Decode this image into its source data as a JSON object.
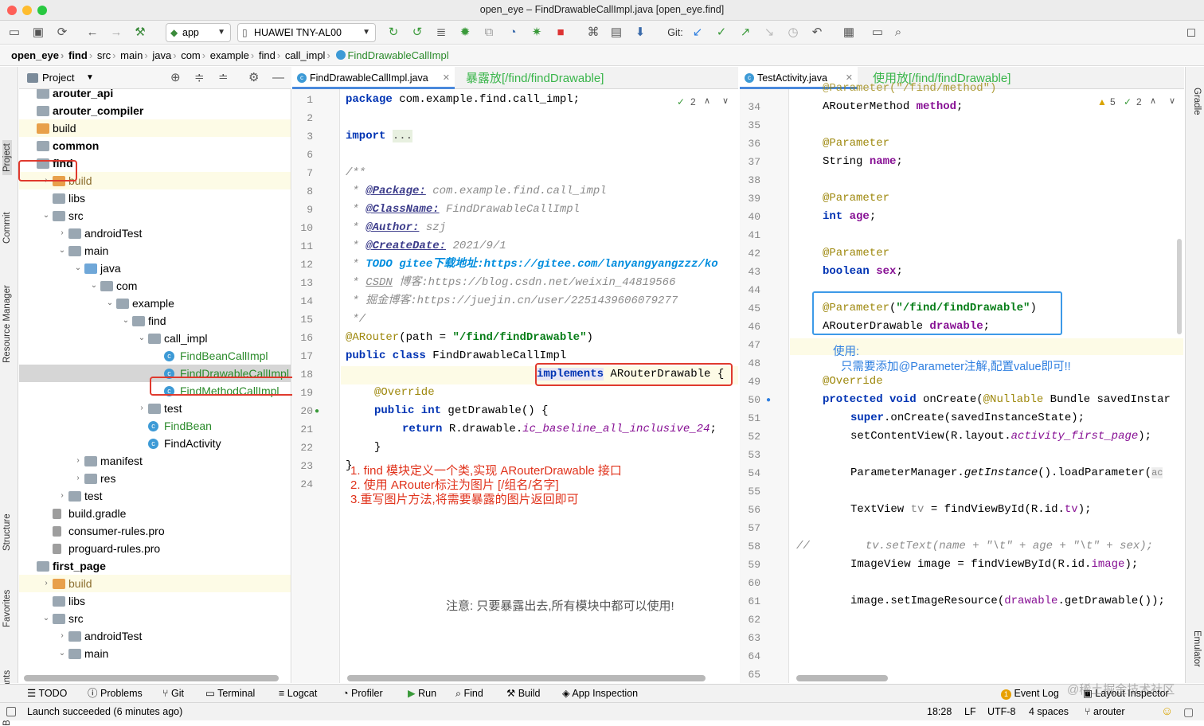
{
  "window": {
    "title": "open_eye – FindDrawableCallImpl.java [open_eye.find]"
  },
  "toolbar": {
    "run_config": "app",
    "device": "HUAWEI TNY-AL00",
    "git_label": "Git:"
  },
  "breadcrumb": [
    "open_eye",
    "find",
    "src",
    "main",
    "java",
    "com",
    "example",
    "find",
    "call_impl",
    "FindDrawableCallImpl"
  ],
  "left_tools": [
    "Project",
    "Commit",
    "Resource Manager",
    "Structure",
    "Favorites",
    "Build Variants"
  ],
  "right_tools": [
    "Gradle",
    "Emulator"
  ],
  "project_panel": {
    "title": "Project"
  },
  "tree": [
    {
      "label": "arouter_api",
      "depth": 0,
      "arrow": "",
      "icon": "mod",
      "bold": true
    },
    {
      "label": "arouter_compiler",
      "depth": 0,
      "arrow": "",
      "icon": "mod",
      "bold": true
    },
    {
      "label": "build",
      "depth": 0,
      "arrow": "",
      "icon": "orange",
      "hl": true
    },
    {
      "label": "common",
      "depth": 0,
      "arrow": "",
      "icon": "mod",
      "bold": true
    },
    {
      "label": "find",
      "depth": 0,
      "arrow": "",
      "icon": "mod",
      "bold": true
    },
    {
      "label": "build",
      "depth": 1,
      "arrow": "›",
      "icon": "orange",
      "hl": true,
      "color": "#8c6e2f"
    },
    {
      "label": "libs",
      "depth": 1,
      "arrow": "",
      "icon": "folder"
    },
    {
      "label": "src",
      "depth": 1,
      "arrow": "⌄",
      "icon": "folder"
    },
    {
      "label": "androidTest",
      "depth": 2,
      "arrow": "›",
      "icon": "folder"
    },
    {
      "label": "main",
      "depth": 2,
      "arrow": "⌄",
      "icon": "folder"
    },
    {
      "label": "java",
      "depth": 3,
      "arrow": "⌄",
      "icon": "blue"
    },
    {
      "label": "com",
      "depth": 4,
      "arrow": "⌄",
      "icon": "folder"
    },
    {
      "label": "example",
      "depth": 5,
      "arrow": "⌄",
      "icon": "folder"
    },
    {
      "label": "find",
      "depth": 6,
      "arrow": "⌄",
      "icon": "folder"
    },
    {
      "label": "call_impl",
      "depth": 7,
      "arrow": "⌄",
      "icon": "folder"
    },
    {
      "label": "FindBeanCallImpl",
      "depth": 8,
      "arrow": "",
      "icon": "class",
      "color": "#2a8a2a"
    },
    {
      "label": "FindDrawableCallImpl",
      "depth": 8,
      "arrow": "",
      "icon": "class",
      "color": "#2a8a2a",
      "selected": true
    },
    {
      "label": "FindMethodCallImpl",
      "depth": 8,
      "arrow": "",
      "icon": "class",
      "color": "#2a8a2a"
    },
    {
      "label": "test",
      "depth": 7,
      "arrow": "›",
      "icon": "folder"
    },
    {
      "label": "FindBean",
      "depth": 7,
      "arrow": "",
      "icon": "class",
      "color": "#2a8a2a"
    },
    {
      "label": "FindActivity",
      "depth": 7,
      "arrow": "",
      "icon": "class"
    },
    {
      "label": "manifest",
      "depth": 3,
      "arrow": "›",
      "icon": "folder"
    },
    {
      "label": "res",
      "depth": 3,
      "arrow": "›",
      "icon": "folder"
    },
    {
      "label": "test",
      "depth": 2,
      "arrow": "›",
      "icon": "folder"
    },
    {
      "label": "build.gradle",
      "depth": 1,
      "arrow": "",
      "icon": "file"
    },
    {
      "label": "consumer-rules.pro",
      "depth": 1,
      "arrow": "",
      "icon": "file"
    },
    {
      "label": "proguard-rules.pro",
      "depth": 1,
      "arrow": "",
      "icon": "file"
    },
    {
      "label": "first_page",
      "depth": 0,
      "arrow": "",
      "icon": "mod",
      "bold": true
    },
    {
      "label": "build",
      "depth": 1,
      "arrow": "›",
      "icon": "orange",
      "hl": true,
      "color": "#8c6e2f"
    },
    {
      "label": "libs",
      "depth": 1,
      "arrow": "",
      "icon": "folder"
    },
    {
      "label": "src",
      "depth": 1,
      "arrow": "⌄",
      "icon": "folder"
    },
    {
      "label": "androidTest",
      "depth": 2,
      "arrow": "›",
      "icon": "folder"
    },
    {
      "label": "main",
      "depth": 2,
      "arrow": "⌄",
      "icon": "folder"
    }
  ],
  "editor_left": {
    "tab": "FindDrawableCallImpl.java",
    "annotation": "暴露放[/find/findDrawable]",
    "check_count": "2",
    "line_numbers": [
      "1",
      "2",
      "3",
      "6",
      "7",
      "8",
      "9",
      "10",
      "11",
      "12",
      "13",
      "14",
      "15",
      "16",
      "17",
      "18",
      "19",
      "20",
      "21",
      "22",
      "23",
      "24"
    ],
    "code": {
      "l1a": "package ",
      "l1b": "com.example.find.call_impl;",
      "l3a": "import ",
      "l3b": "...",
      "l5": "/**",
      "l6a": " * ",
      "l6b": "@Package:",
      "l6c": " com.example.find.call_impl",
      "l7a": " * ",
      "l7b": "@ClassName:",
      "l7c": " FindDrawableCallImpl",
      "l8a": " * ",
      "l8b": "@Author:",
      "l8c": " szj",
      "l9a": " * ",
      "l9b": "@CreateDate:",
      "l9c": " 2021/9/1",
      "l10a": " * ",
      "l10b": "TODO gitee下载地址:https://gitee.com/lanyangyangzzz/ko",
      "l11a": " * ",
      "l11b": "CSDN",
      "l11c": " 博客:https://blog.csdn.net/weixin_44819566",
      "l12": " * 掘金博客:https://juejin.cn/user/2251439606079277",
      "l13": " */",
      "l14a": "@ARouter",
      "l14b": "(path = ",
      "l14c": "\"/find/findDrawable\"",
      "l14d": ")",
      "l15a": "public class ",
      "l15b": "FindDrawableCallImpl",
      "l16a": "implements",
      "l16b": " ARouterDrawable {",
      "l18": "@Override",
      "l19a": "public int ",
      "l19b": "getDrawable",
      "l19c": "() {",
      "l20a": "return ",
      "l20b": "R.drawable.",
      "l20c": "ic_baseline_all_inclusive_24",
      ";": ";",
      "l21": "}",
      "l22": "}"
    },
    "notes": [
      "1. find 模块定义一个类,实现 ARouterDrawable 接口",
      "2. 使用 ARouter标注为图片 [/组名/名字]",
      "3.重写图片方法,将需要暴露的图片返回即可"
    ],
    "note_bottom": "注意: 只要暴露出去,所有模块中都可以使用!"
  },
  "editor_right": {
    "tab": "TestActivity.java",
    "annotation": "使用放[/find/findDrawable]",
    "warn_count": "5",
    "check_count": "2",
    "line_numbers": [
      "34",
      "35",
      "36",
      "37",
      "38",
      "39",
      "40",
      "41",
      "42",
      "43",
      "44",
      "45",
      "46",
      "47",
      "48",
      "49",
      "50",
      "51",
      "52",
      "53",
      "54",
      "55",
      "56",
      "57",
      "58",
      "59",
      "60",
      "61",
      "62",
      "63",
      "64",
      "65"
    ],
    "code": {
      "r0": "@Parameter(\"/find/method\")",
      "r34a": "ARouterMethod ",
      "r34b": "method",
      ";": ";",
      "r36": "@Parameter",
      "r37a": "String ",
      "r37b": "name",
      "r39": "@Parameter",
      "r40a": "int ",
      "r40b": "age",
      "r42": "@Parameter",
      "r43a": "boolean ",
      "r43b": "sex",
      "r45a": "@Parameter",
      "r45b": "(",
      "r45c": "\"/find/findDrawable\"",
      "r45d": ")",
      "r46a": "ARouterDrawable ",
      "r46b": "drawable",
      "r49": "@Override",
      "r50a": "protected void ",
      "r50b": "onCreate(",
      "r50c": "@Nullable",
      " r50d": "",
      "r50e": " Bundle savedInstar",
      "r51a": "super",
      "r51b": ".onCreate(savedInstanceState);",
      "r52a": "setContentView(R.layout.",
      "r52b": "activity_first_page",
      "r52c": ");",
      "r54a": "ParameterManager.",
      "r54b": "getInstance",
      "r54c": "().loadParameter(",
      "r54d": "ac",
      "r56a": "TextView ",
      "r56b": "tv",
      " r56c": "",
      "r56d": " = findViewById(R.id.",
      "r56e": "tv",
      "r56f": ");",
      "r58a": "//",
      "r58b": "tv.setText(name + \"\\t\" + age + \"\\t\" + sex);",
      "r59a": "ImageView image = findViewById(R.id.",
      "r59b": "image",
      "r59c": ");",
      "r61a": "image.setImageResource(",
      "r61b": "drawable",
      ".": ".",
      "r61c": ".getDrawable());"
    },
    "usage_title": "使用:",
    "usage_text": "只需要添加@Parameter注解,配置value即可!!"
  },
  "bottom_tools": [
    "TODO",
    "Problems",
    "Git",
    "Terminal",
    "Logcat",
    "Profiler",
    "Run",
    "Find",
    "Build",
    "App Inspection"
  ],
  "bottom_right": {
    "event_log": "Event Log",
    "event_count": "1",
    "layout_inspector": "Layout Inspector",
    "watermark": "@稀土掘金技术社区"
  },
  "status": {
    "message": "Launch succeeded (6 minutes ago)",
    "position": "18:28",
    "line_sep": "LF",
    "encoding": "UTF-8",
    "indent": "4 spaces",
    "branch": "arouter"
  },
  "colors": {
    "accent": "#4a89dc",
    "annotation_red": "#e03a2e",
    "annotation_blue": "#2f7fe0",
    "annotation_green": "#39b54a"
  }
}
